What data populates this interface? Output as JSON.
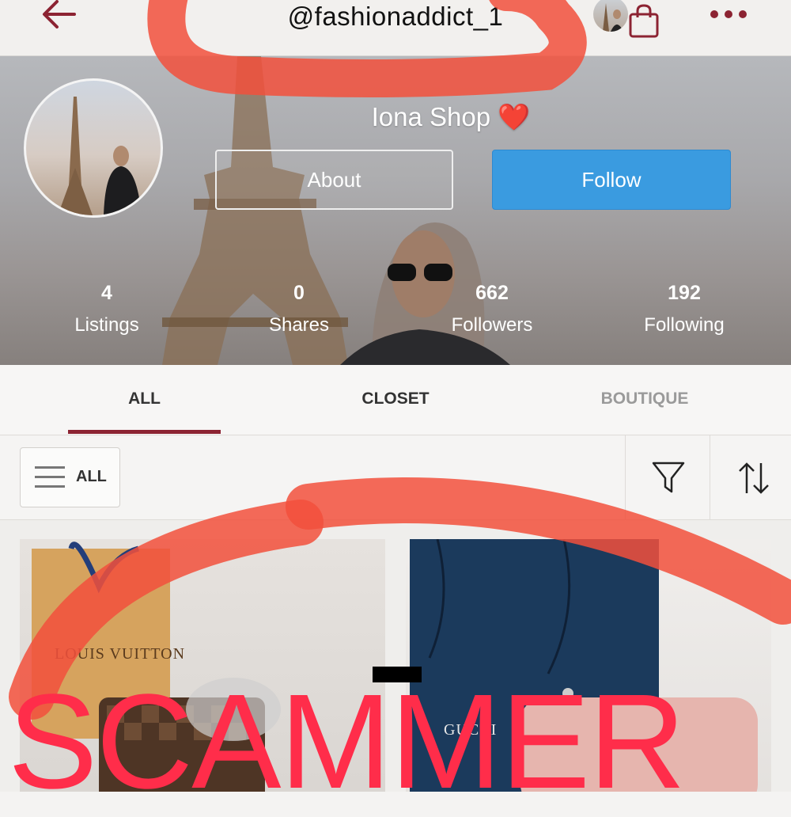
{
  "topbar": {
    "handle": "@fashionaddict_1",
    "back_icon": "back-arrow-icon",
    "bag_icon": "shopping-bag-icon",
    "more_icon": "more-dots-icon"
  },
  "profile": {
    "shop_name": "Iona Shop",
    "heart": "❤️",
    "about_label": "About",
    "follow_label": "Follow",
    "stats": [
      {
        "value": "4",
        "label": "Listings"
      },
      {
        "value": "0",
        "label": "Shares"
      },
      {
        "value": "662",
        "label": "Followers"
      },
      {
        "value": "192",
        "label": "Following"
      }
    ]
  },
  "tabs": [
    {
      "label": "ALL",
      "active": true
    },
    {
      "label": "CLOSET",
      "active": false
    },
    {
      "label": "BOUTIQUE",
      "active": false
    }
  ],
  "filter": {
    "dropdown_label": "ALL",
    "filter_icon": "funnel-icon",
    "sort_icon": "sort-arrows-icon"
  },
  "listings": [
    {
      "brand_text": "LOUIS VUITTON"
    },
    {
      "brand_text": "GUCCI"
    }
  ],
  "overlay": {
    "stamp_text": "SCAMMER"
  },
  "colors": {
    "accent": "#8c2332",
    "follow_button": "#3a9be0",
    "annotation_red": "#ff2d4a"
  }
}
